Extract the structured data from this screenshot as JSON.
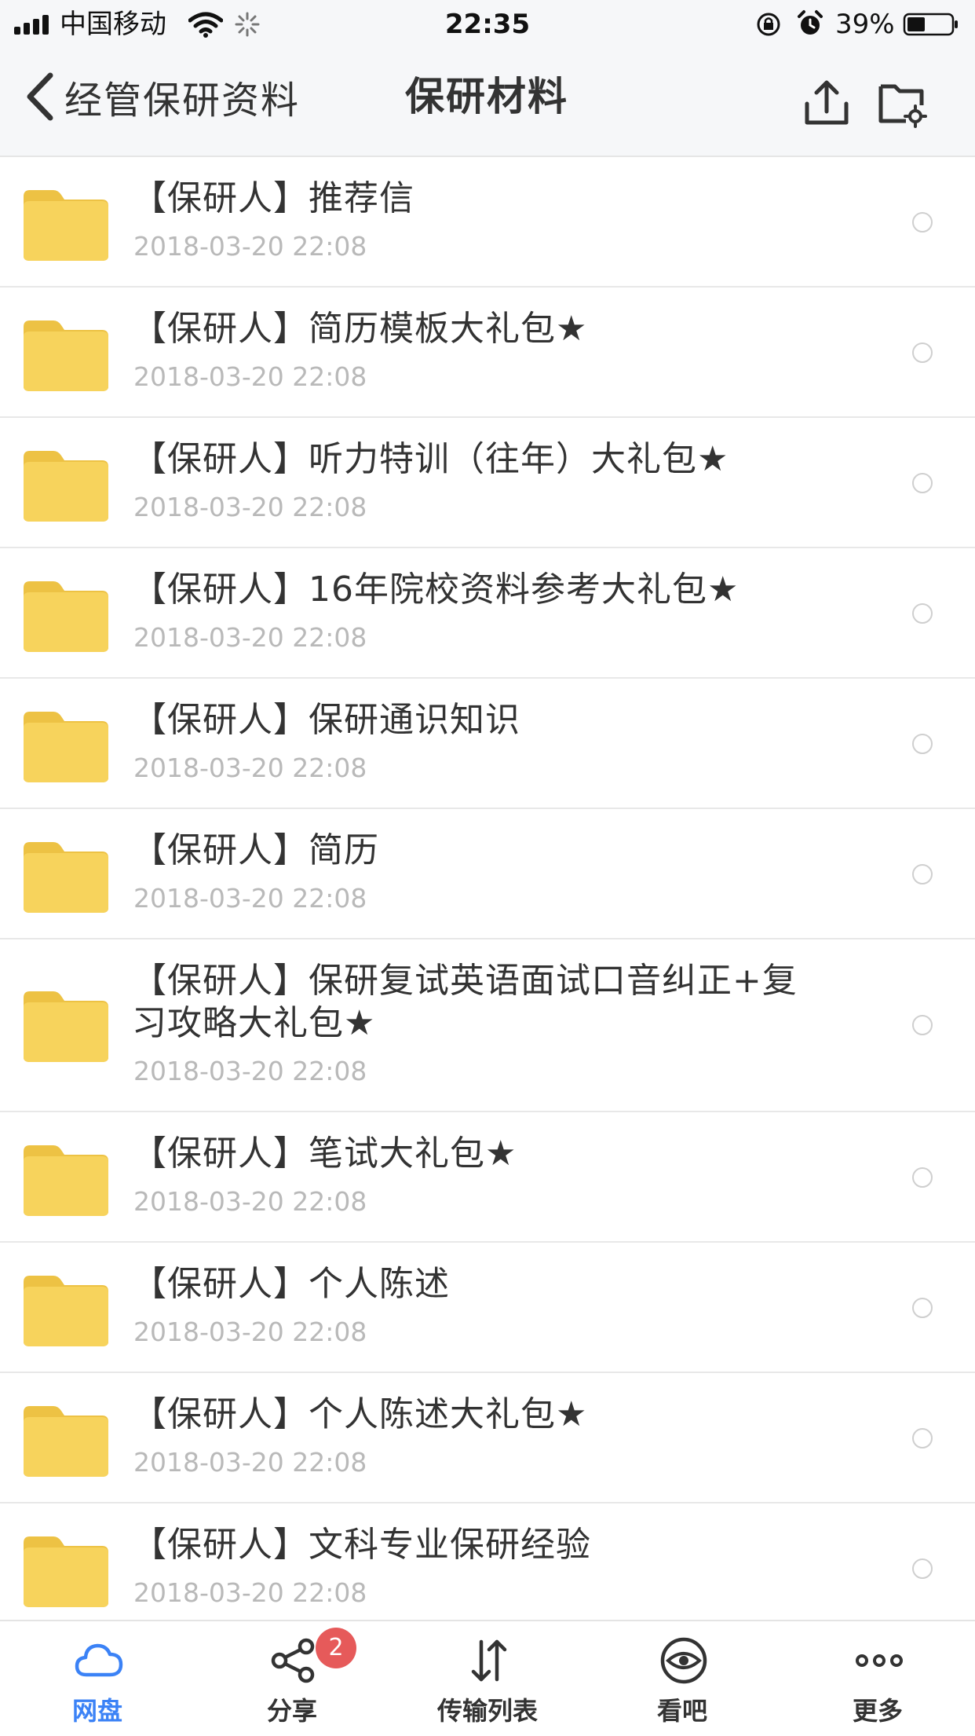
{
  "status_bar": {
    "carrier": "中国移动",
    "time": "22:35",
    "battery_percent": "39%"
  },
  "nav": {
    "back_label": "经管保研资料",
    "title": "保研材料"
  },
  "colors": {
    "folder": "#f7d35c",
    "folder_tab": "#edc244",
    "accent": "#3b82f6",
    "badge": "#e65a5a",
    "date_text": "#b9b9b9"
  },
  "files": [
    {
      "name": "【保研人】推荐信",
      "date": "2018-03-20 22:08"
    },
    {
      "name": "【保研人】简历模板大礼包★",
      "date": "2018-03-20 22:08"
    },
    {
      "name": "【保研人】听力特训（往年）大礼包★",
      "date": "2018-03-20 22:08"
    },
    {
      "name": "【保研人】16年院校资料参考大礼包★",
      "date": "2018-03-20 22:08"
    },
    {
      "name": "【保研人】保研通识知识",
      "date": "2018-03-20 22:08"
    },
    {
      "name": "【保研人】简历",
      "date": "2018-03-20 22:08"
    },
    {
      "name": "【保研人】保研复试英语面试口音纠正+复习攻略大礼包★",
      "date": "2018-03-20 22:08"
    },
    {
      "name": "【保研人】笔试大礼包★",
      "date": "2018-03-20 22:08"
    },
    {
      "name": "【保研人】个人陈述",
      "date": "2018-03-20 22:08"
    },
    {
      "name": "【保研人】个人陈述大礼包★",
      "date": "2018-03-20 22:08"
    },
    {
      "name": "【保研人】文科专业保研经验",
      "date": "2018-03-20 22:08"
    }
  ],
  "tabs": [
    {
      "label": "网盘",
      "icon": "cloud-icon",
      "active": true
    },
    {
      "label": "分享",
      "icon": "share-icon",
      "badge": "2"
    },
    {
      "label": "传输列表",
      "icon": "transfer-icon"
    },
    {
      "label": "看吧",
      "icon": "eye-icon"
    },
    {
      "label": "更多",
      "icon": "more-icon"
    }
  ]
}
